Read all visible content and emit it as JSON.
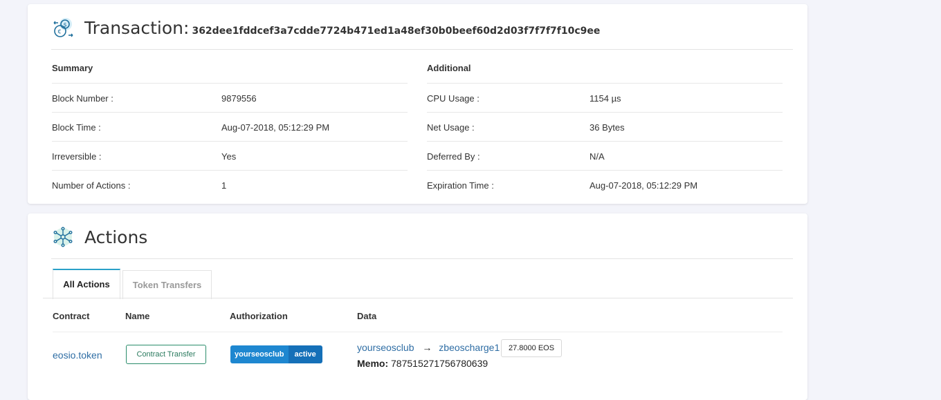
{
  "transaction": {
    "title": "Transaction:",
    "hash": "362dee1fddcef3a7cdde7724b471ed1a48ef30b0beef60d2d03f7f7f7f10c9ee",
    "summary": {
      "heading": "Summary",
      "rows": [
        {
          "label": "Block Number :",
          "value": "9879556"
        },
        {
          "label": "Block Time :",
          "value": "Aug-07-2018, 05:12:29 PM"
        },
        {
          "label": "Irreversible :",
          "value": "Yes"
        },
        {
          "label": "Number of Actions :",
          "value": "1"
        }
      ]
    },
    "additional": {
      "heading": "Additional",
      "rows": [
        {
          "label": "CPU Usage :",
          "value": "1154 µs"
        },
        {
          "label": "Net Usage :",
          "value": "36 Bytes"
        },
        {
          "label": "Deferred By :",
          "value": "N/A"
        },
        {
          "label": "Expiration Time :",
          "value": "Aug-07-2018, 05:12:29 PM"
        }
      ]
    }
  },
  "actions": {
    "title": "Actions",
    "tabs": [
      "All Actions",
      "Token Transfers"
    ],
    "columns": [
      "Contract",
      "Name",
      "Authorization",
      "Data"
    ],
    "row": {
      "contract": "eosio.token",
      "name": "Contract Transfer",
      "auth_actor": "yourseosclub",
      "auth_permission": "active",
      "from": "yourseosclub",
      "arrow": "→",
      "to": "zbeoscharge1",
      "amount": "27.8000 EOS",
      "memo_label": "Memo:",
      "memo": "787515271756780639"
    }
  },
  "colors": {
    "link": "#2e6da4",
    "accent_teal": "#2aa0c8",
    "auth_blue": "#1e87d0"
  }
}
